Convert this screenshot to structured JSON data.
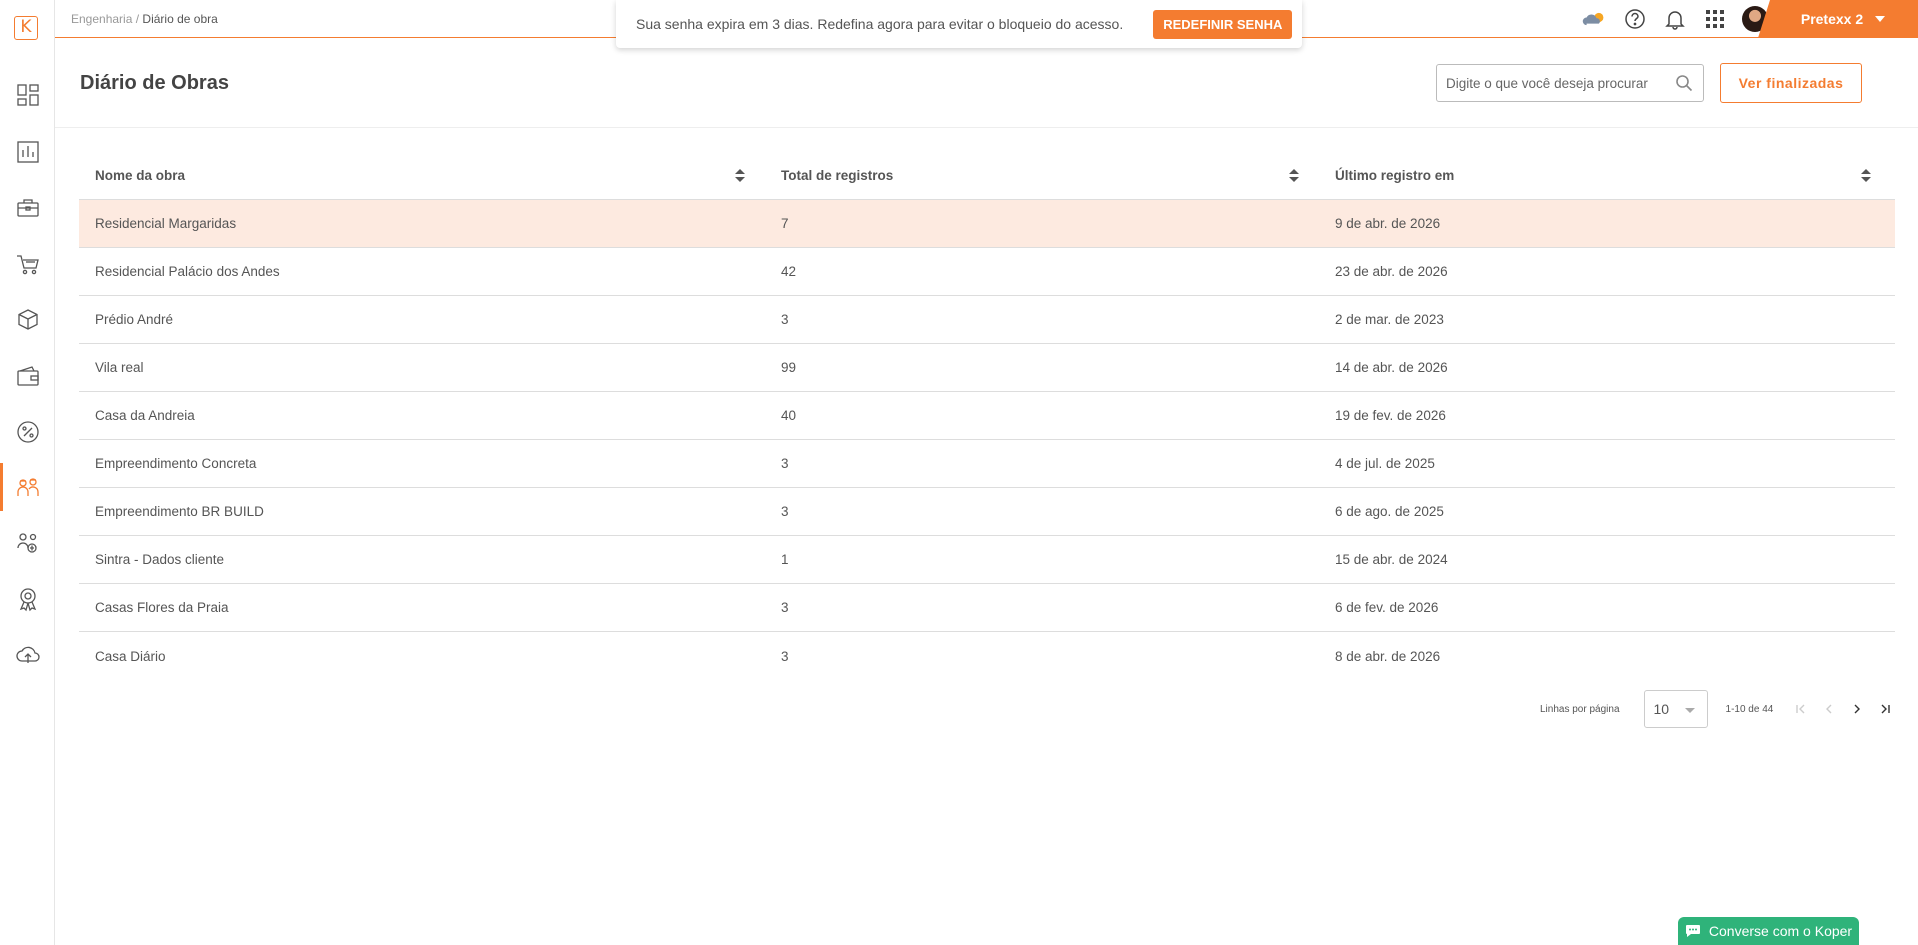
{
  "logo": {
    "letter": "K"
  },
  "breadcrumb": {
    "parent": "Engenharia",
    "separator": "/",
    "current": "Diário de obra"
  },
  "banner": {
    "message": "Sua senha expira em 3 dias. Redefina agora para evitar o bloqueio do acesso.",
    "button_label": "REDEFINIR SENHA"
  },
  "user": {
    "name": "Pretexx 2"
  },
  "page": {
    "title": "Diário de Obras"
  },
  "search": {
    "placeholder": "Digite o que você deseja procurar"
  },
  "actions": {
    "view_finished_label": "Ver finalizadas"
  },
  "table": {
    "headers": [
      "Nome da obra",
      "Total de registros",
      "Último registro em"
    ],
    "rows": [
      {
        "name": "Residencial Margaridas",
        "total": "7",
        "last": "9 de abr. de 2026"
      },
      {
        "name": "Residencial Palácio dos Andes",
        "total": "42",
        "last": "23 de abr. de 2026"
      },
      {
        "name": "Prédio André",
        "total": "3",
        "last": "2 de mar. de 2023"
      },
      {
        "name": "Vila real",
        "total": "99",
        "last": "14 de abr. de 2026"
      },
      {
        "name": "Casa da Andreia",
        "total": "40",
        "last": "19 de fev. de 2026"
      },
      {
        "name": "Empreendimento Concreta",
        "total": "3",
        "last": "4 de jul. de 2025"
      },
      {
        "name": "Empreendimento BR BUILD",
        "total": "3",
        "last": "6 de ago. de 2025"
      },
      {
        "name": "Sintra - Dados cliente",
        "total": "1",
        "last": "15 de abr. de 2024"
      },
      {
        "name": "Casas Flores da Praia",
        "total": "3",
        "last": "6 de fev. de 2026"
      },
      {
        "name": "Casa Diário",
        "total": "3",
        "last": "8 de abr. de 2026"
      }
    ]
  },
  "pagination": {
    "rows_per_page_label": "Linhas por página",
    "rows_per_page_value": "10",
    "range": "1-10 de 44"
  },
  "chat": {
    "label": "Converse com o Koper"
  },
  "colors": {
    "accent": "#f47c30",
    "highlight_row": "#fdeae0",
    "chat": "#2fb37a"
  }
}
